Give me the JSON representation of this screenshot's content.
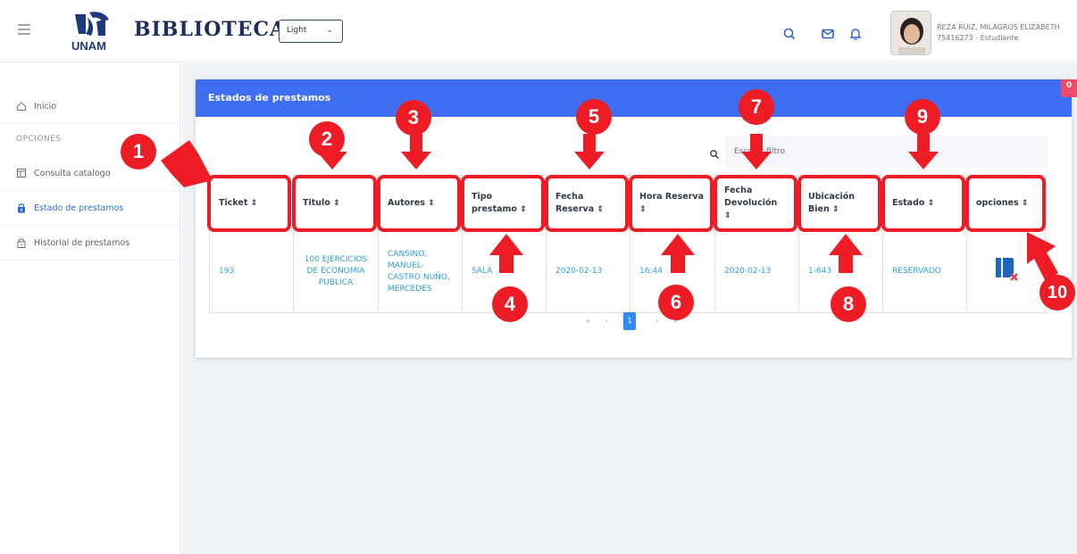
{
  "header": {
    "logo_text": "UNAM",
    "brand": "BIBLIOTECA",
    "theme_select": {
      "value": "Light"
    },
    "icons": [
      "search-icon",
      "mail-icon",
      "bell-icon"
    ],
    "user": {
      "name": "REZA RUIZ, MILAGROS ELIZABETH",
      "sub": "75416273 - Estudiante"
    }
  },
  "sidebar": {
    "home_label": "Inicio",
    "section_label": "OPCIONES",
    "items": [
      {
        "label": "Consulta catalogo",
        "icon": "catalog-icon"
      },
      {
        "label": "Estado de prestamos",
        "icon": "lock-icon",
        "active": true
      },
      {
        "label": "Historial de prestamos",
        "icon": "lock-icon"
      }
    ]
  },
  "card": {
    "title": "Estados de prestamos",
    "corner_badge": "0",
    "search_placeholder": "Escribir filtro",
    "sort_glyph": "⇕",
    "columns": [
      {
        "line1": "Ticket",
        "line2": ""
      },
      {
        "line1": "Titulo",
        "line2": ""
      },
      {
        "line1": "Autores",
        "line2": ""
      },
      {
        "line1": "Tipo",
        "line2": "prestamo"
      },
      {
        "line1": "Fecha",
        "line2": "Reserva"
      },
      {
        "line1": "Hora Reserva",
        "line2": ""
      },
      {
        "line1": "Fecha",
        "line2": "Devolución"
      },
      {
        "line1": "Ubicación",
        "line2": "Bien"
      },
      {
        "line1": "Estado",
        "line2": ""
      },
      {
        "line1": "opciones",
        "line2": ""
      }
    ],
    "row": {
      "ticket": "193",
      "titulo": "100 EJERCICIOS DE ECONOMIA PUBLICA",
      "autores": "CANSINO, MANUEL- CASTRO NUÑO, MERCEDES",
      "tipo": "SALA",
      "fecha_reserva": "2020-02-13",
      "hora_reserva": "16:44",
      "fecha_devolucion": "2020-02-13",
      "ubicacion": "1-643",
      "estado": "RESERVADO",
      "opciones_icon": "cancel-reservation-icon"
    },
    "pagination": {
      "first": "«",
      "prev": "‹",
      "current": "1",
      "next": "›",
      "last": "»"
    }
  },
  "callouts": [
    "1",
    "2",
    "3",
    "4",
    "5",
    "6",
    "7",
    "8",
    "9",
    "10"
  ],
  "colors": {
    "header_blue": "#3f6ef2",
    "callout_red": "#ee1c25",
    "link_blue": "#2e9fd0",
    "badge_pink": "#f04b6b"
  }
}
